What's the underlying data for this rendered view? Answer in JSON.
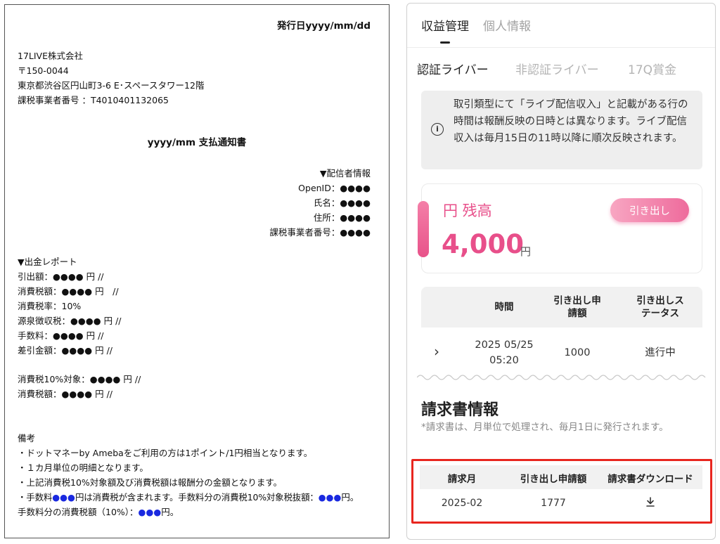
{
  "document": {
    "issue_date": "発行日yyyy/mm/dd",
    "company": {
      "name": "17LIVE株式会社",
      "postal": "〒150-0044",
      "address": "東京都渋谷区円山町3-6 E･スペースタワー12階",
      "tax_id": "課税事業者番号 ：T4010401132065"
    },
    "title": "yyyy/mm 支払通知書",
    "streamer": {
      "heading": "▼配信者情報",
      "rows": [
        "OpenID：●●●●",
        "氏名：●●●●",
        "住所：●●●●",
        "課税事業者番号：●●●●"
      ]
    },
    "report": {
      "heading": "▼出金レポート",
      "rows": [
        "引出額：●●●● 円 //",
        "消費税額：●●●● 円　//",
        "消費税率：10%",
        "源泉徴収税：●●●● 円 //",
        "手数料：●●●● 円 //",
        "差引金額：●●●● 円 //"
      ],
      "tax_rows": [
        "消費税10%対象：●●●● 円 //",
        "消費税額：●●●● 円 //"
      ]
    },
    "notes": {
      "heading": "備考",
      "line1": "・ドットマネーby Amebaをご利用の方は1ポイント/1円相当となります。",
      "line2": "・１カ月単位の明細となります。",
      "line3": "・上記消費税10%対象額及び消費税額は報酬分の金額となります。",
      "line4_a": "・手数料",
      "line4_dots": "●●●",
      "line4_b": "円は消費税が含まれます。手数料分の消費税10%対象税抜額：",
      "line4_dots2": "●●●",
      "line4_c": "円。",
      "line5_a": "手数料分の消費税額（10%）：",
      "line5_dots": "●●●",
      "line5_b": "円。"
    }
  },
  "app": {
    "top_tabs": [
      {
        "label": "収益管理",
        "active": true
      },
      {
        "label": "個人情報",
        "active": false
      }
    ],
    "sub_tabs": [
      {
        "label": "認証ライバー",
        "active": true
      },
      {
        "label": "非認証ライバー",
        "active": false
      },
      {
        "label": "17Q賞金",
        "active": false
      }
    ],
    "notice": {
      "icon": "info-icon",
      "text": "取引類型にて「ライブ配信収入」と記載がある行の時間は報酬反映の日時とは異なります。ライブ配信収入は毎月15日の11時以降に順次反映されます。"
    },
    "balance": {
      "label": "円 残高",
      "amount": "4,000",
      "unit": "円",
      "withdraw_label": "引き出し"
    },
    "withdraw_table": {
      "headers": [
        "時間",
        "引き出し申請額",
        "引き出しステータス"
      ],
      "rows": [
        {
          "date": "2025 05/25",
          "time": "05:20",
          "amount": "1000",
          "status": "進行中"
        }
      ]
    },
    "invoice": {
      "title": "請求書情報",
      "note": "*請求書は、月単位で処理され、毎月1日に発行されます。",
      "headers": [
        "請求月",
        "引き出し申請額",
        "請求書ダウンロード"
      ],
      "rows": [
        {
          "month": "2025-02",
          "amount": "1777",
          "download_icon": "download-icon"
        }
      ]
    },
    "colors": {
      "accent_pink": "#e84f8a",
      "highlight_red": "#e8261f",
      "dots_blue": "#1a29e0"
    }
  }
}
